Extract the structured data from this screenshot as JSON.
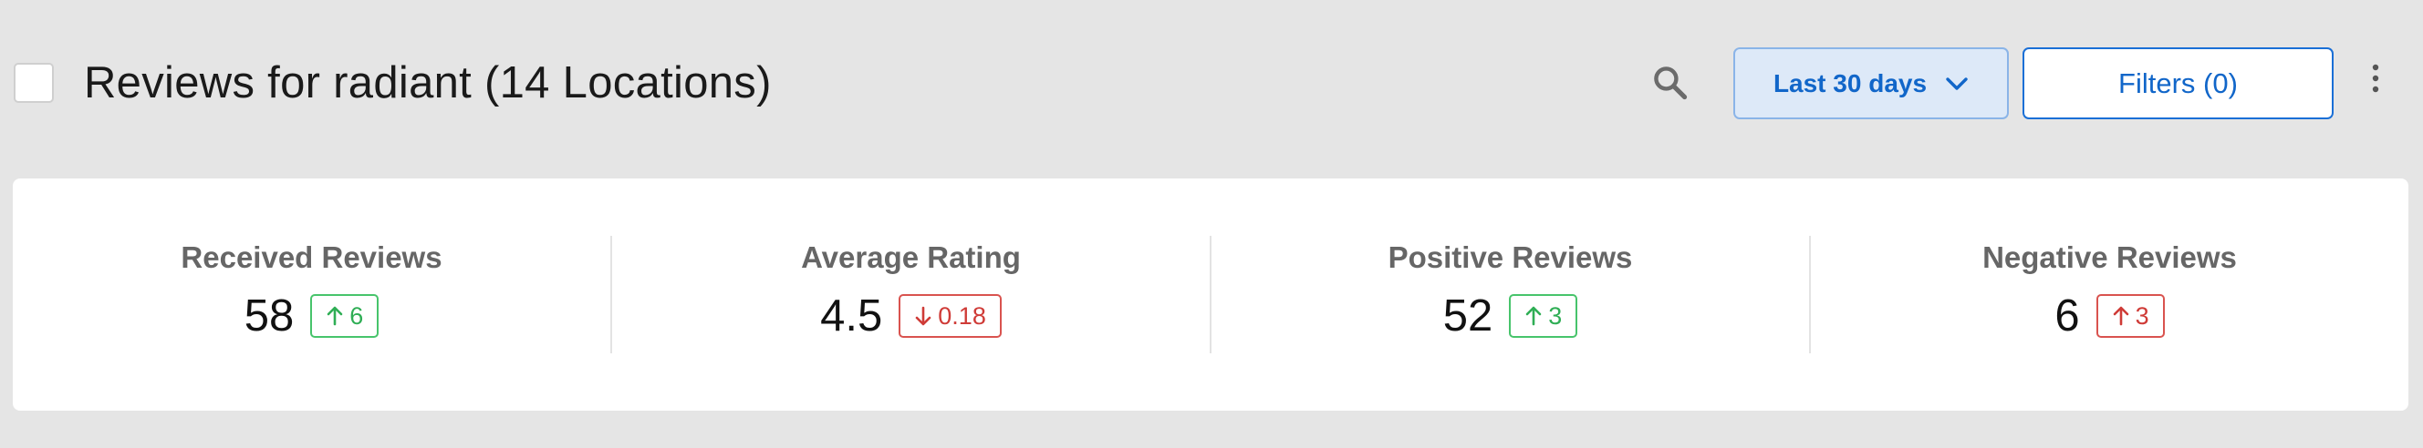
{
  "header": {
    "title": "Reviews for radiant (14 Locations)",
    "date_range_label": "Last 30 days",
    "filters_label": "Filters (0)"
  },
  "stats": [
    {
      "label": "Received Reviews",
      "value": "58",
      "delta": "6",
      "direction": "up",
      "tone": "positive",
      "color": "#2fae55"
    },
    {
      "label": "Average Rating",
      "value": "4.5",
      "delta": "0.18",
      "direction": "down",
      "tone": "negative",
      "color": "#cf3b37"
    },
    {
      "label": "Positive Reviews",
      "value": "52",
      "delta": "3",
      "direction": "up",
      "tone": "positive",
      "color": "#2fae55"
    },
    {
      "label": "Negative Reviews",
      "value": "6",
      "delta": "3",
      "direction": "up",
      "tone": "negative",
      "color": "#cf3b37"
    }
  ],
  "icons": {
    "search": "search-icon",
    "dropdown": "chevron-down-icon",
    "more": "more-vertical-icon",
    "up": "arrow-up-icon",
    "down": "arrow-down-icon"
  },
  "colors": {
    "accent": "#1166c9",
    "background": "#e5e5e5",
    "positive": "#2fae55",
    "negative": "#cf3b37"
  }
}
